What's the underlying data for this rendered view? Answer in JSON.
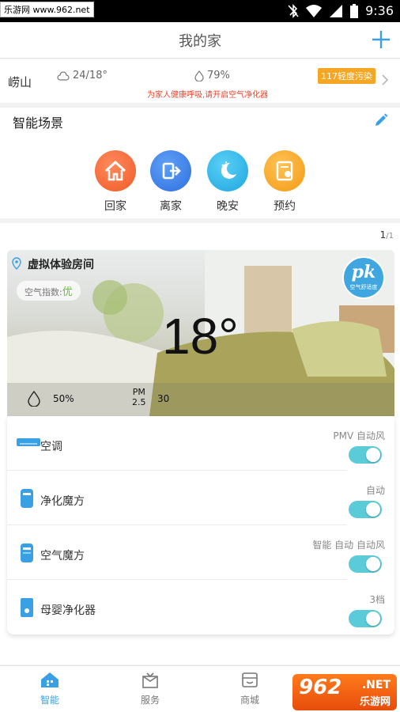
{
  "status_bar": {
    "watermark": "乐游网 www.962.net",
    "time": "9:36"
  },
  "header": {
    "title": "我的家"
  },
  "weather": {
    "city": "崂山",
    "temperature": "24/18°",
    "humidity": "79%",
    "aqi_badge": "117轻度污染",
    "tip": "为家人健康呼吸,请开启空气净化器"
  },
  "scenes": {
    "title": "智能场景",
    "items": [
      {
        "label": "回家",
        "icon": "home-icon",
        "color": "#f26b3a"
      },
      {
        "label": "离家",
        "icon": "exit-door-icon",
        "color": "#3d7ee8"
      },
      {
        "label": "晚安",
        "icon": "moon-icon",
        "color": "#2fb4e6"
      },
      {
        "label": "预约",
        "icon": "schedule-icon",
        "color": "#f5a623"
      }
    ]
  },
  "room": {
    "page_current": "1",
    "page_total": "/1",
    "name": "虚拟体验房间",
    "air_index_label": "空气指数:",
    "air_index_value": "优",
    "pk_main": "pk",
    "pk_sub": "空气舒适度",
    "temperature": "18°",
    "humidity": "50%",
    "pm_label_top": "PM",
    "pm_label_bottom": "2.5",
    "pm_value": "30"
  },
  "devices": [
    {
      "name": "空调",
      "mode": "PMV 自动风",
      "icon": "air-conditioner-icon",
      "on": true
    },
    {
      "name": "净化魔方",
      "mode": "自动",
      "icon": "purifier-cube-icon",
      "on": true
    },
    {
      "name": "空气魔方",
      "mode": "智能 自动 自动风",
      "icon": "air-cube-icon",
      "on": true
    },
    {
      "name": "母婴净化器",
      "mode": "3档",
      "icon": "baby-purifier-icon",
      "on": true
    }
  ],
  "bottom_nav": [
    {
      "label": "智能",
      "icon": "smart-home-icon",
      "active": true
    },
    {
      "label": "服务",
      "icon": "service-gift-icon",
      "active": false
    },
    {
      "label": "商城",
      "icon": "store-icon",
      "active": false
    }
  ],
  "watermark_bottom": {
    "num": "962",
    "net": ".NET",
    "cn": "乐游网"
  },
  "colors": {
    "accent": "#3aa0e4",
    "toggle": "#5ccbd9",
    "tip": "#e8452c",
    "badge": "#f5a623"
  }
}
